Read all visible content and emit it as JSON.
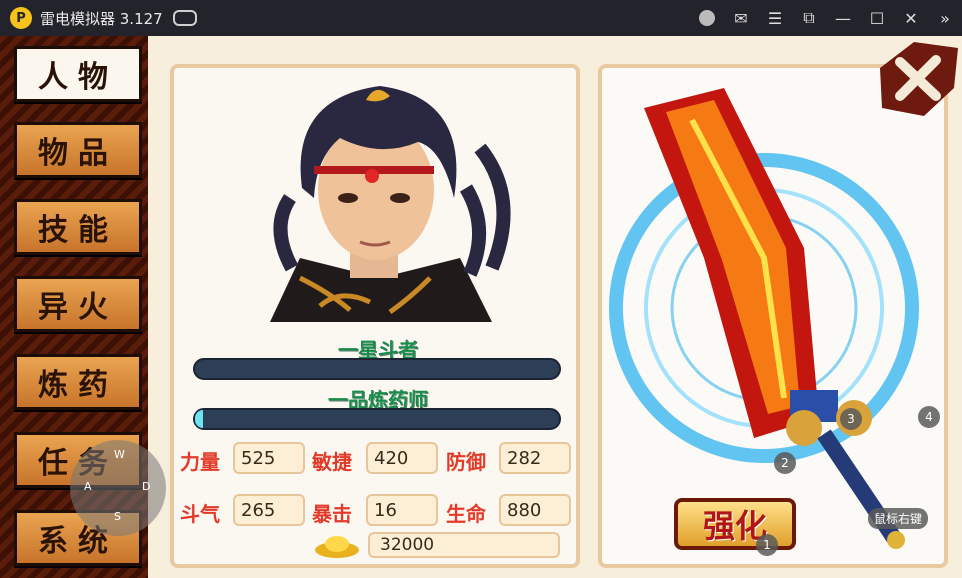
{
  "window": {
    "logo_glyph": "P",
    "title": "雷电模拟器 3.127",
    "controls": [
      "account-icon",
      "mail-icon",
      "menu-icon",
      "screenshot-icon",
      "minimize-icon",
      "maximize-icon",
      "close-icon",
      "expand-sidebar-icon"
    ]
  },
  "sidebar": {
    "tabs": [
      {
        "label": "人物",
        "active": true
      },
      {
        "label": "物品",
        "active": false
      },
      {
        "label": "技能",
        "active": false
      },
      {
        "label": "异火",
        "active": false
      },
      {
        "label": "炼药",
        "active": false
      },
      {
        "label": "任务",
        "active": false
      },
      {
        "label": "系统",
        "active": false
      }
    ]
  },
  "character": {
    "rank_title": "一星斗者",
    "alchemy_title": "一品炼药师",
    "stats": [
      {
        "label": "力量",
        "value": "525"
      },
      {
        "label": "敏捷",
        "value": "420"
      },
      {
        "label": "防御",
        "value": "282"
      },
      {
        "label": "斗气",
        "value": "265"
      },
      {
        "label": "暴击",
        "value": "16"
      },
      {
        "label": "生命",
        "value": "880"
      }
    ],
    "gold": "32000"
  },
  "weapon": {
    "enhance_label": "强化"
  },
  "overlay": {
    "joystick_keys": {
      "up": "W",
      "left": "A",
      "down": "S",
      "right": "D"
    },
    "badges": [
      "1",
      "2",
      "3",
      "4"
    ],
    "right_click_hint": "鼠标右键"
  },
  "colors": {
    "titlebar": "#23242b",
    "rank_text": "#1a8c4a",
    "stat_label": "#e33b2a",
    "enhance_text": "#b01616"
  }
}
